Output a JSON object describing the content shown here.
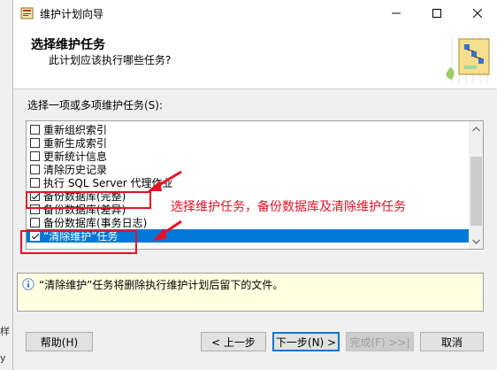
{
  "window": {
    "title": "维护计划向导",
    "controls": [
      "minimize",
      "maximize",
      "close"
    ]
  },
  "outside": {
    "fragments": [
      "样",
      "y"
    ]
  },
  "header": {
    "title": "选择维护任务",
    "subtitle": "此计划应该执行哪些任务?"
  },
  "task_section": {
    "label": "选择一项或多项维护任务(S):"
  },
  "tasks": [
    {
      "label": "重新组织索引",
      "checked": false,
      "selected": false
    },
    {
      "label": "重新生成索引",
      "checked": false,
      "selected": false
    },
    {
      "label": "更新统计信息",
      "checked": false,
      "selected": false
    },
    {
      "label": "清除历史记录",
      "checked": false,
      "selected": false
    },
    {
      "label": "执行 SQL Server 代理作业",
      "checked": false,
      "selected": false
    },
    {
      "label": "备份数据库(完整)",
      "checked": true,
      "selected": false
    },
    {
      "label": "备份数据库(差异)",
      "checked": false,
      "selected": false
    },
    {
      "label": "备份数据库(事务日志)",
      "checked": false,
      "selected": false
    },
    {
      "label": "“清除维护”任务",
      "checked": true,
      "selected": true
    }
  ],
  "annotation": {
    "text": "选择维护任务，备份数据库及清除维护任务",
    "color": "#e81123"
  },
  "description": {
    "text": "“清除维护”任务将删除执行维护计划后留下的文件。"
  },
  "buttons": {
    "help": "帮助(H)",
    "back": "< 上一步",
    "next": "下一步(N) >",
    "finish": "完成(F) >>|",
    "cancel": "取消"
  },
  "colors": {
    "selection": "#0078d7",
    "annotation": "#e81123",
    "info_panel": "#ffffe1"
  }
}
